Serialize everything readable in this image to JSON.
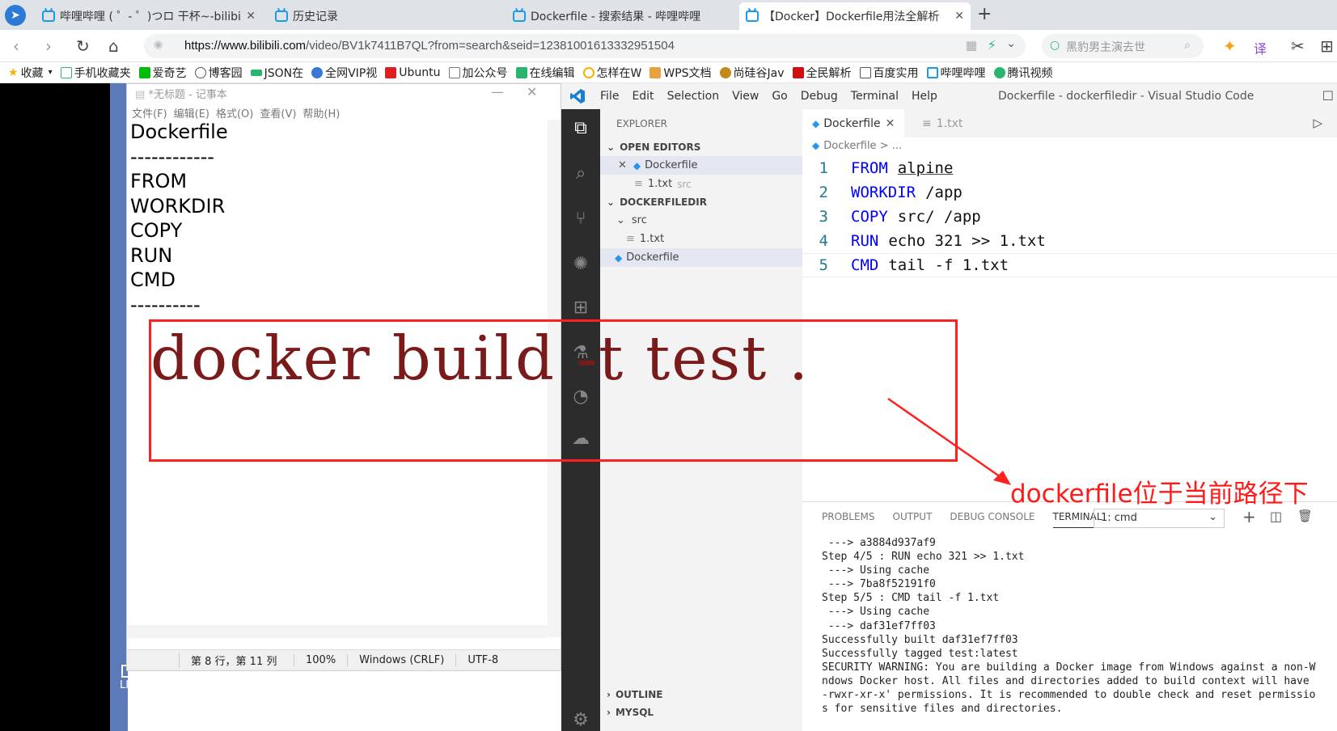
{
  "browser": {
    "tabs": [
      {
        "title": "哔哩哔哩 ( ゜- ゜)つロ 干杯~-bilibi",
        "active": false
      },
      {
        "title": "历史记录",
        "active": false
      },
      {
        "title": "Dockerfile - 搜索结果 - 哔哩哔哩",
        "active": false
      },
      {
        "title": "【Docker】Dockerfile用法全解析",
        "active": true
      }
    ],
    "url_host": "https://www.bilibili.com",
    "url_path": "/video/BV1k7411B7QL?from=search&seid=12381001613332951504",
    "search_placeholder": "黑豹男主演去世",
    "bookmarks": [
      "收藏",
      "手机收藏夹",
      "爱奇艺",
      "博客园",
      "JSON在",
      "全网VIP视",
      "Ubuntu",
      "加公众号",
      "在线编辑",
      "怎样在W",
      "WPS文档",
      "尚硅谷Jav",
      "全民解析",
      "百度实用",
      "哔哩哔哩",
      "腾讯视频"
    ]
  },
  "desktop": {
    "licecap_label": "LICEcap"
  },
  "notepad": {
    "title": "*无标题 - 记事本",
    "menu": [
      "文件(F)",
      "编辑(E)",
      "格式(O)",
      "查看(V)",
      "帮助(H)"
    ],
    "text": "Dockerfile\n------------\nFROM\nWORKDIR\nCOPY\nRUN\nCMD\n----------",
    "status": {
      "position": "第 8 行，第 11 列",
      "zoom": "100%",
      "line_ending": "Windows (CRLF)",
      "encoding": "UTF-8"
    }
  },
  "vscode": {
    "menu": [
      "File",
      "Edit",
      "Selection",
      "View",
      "Go",
      "Debug",
      "Terminal",
      "Help"
    ],
    "window_title": "Dockerfile - dockerfiledir - Visual Studio Code",
    "explorer_title": "EXPLORER",
    "open_editors_title": "OPEN EDITORS",
    "open_editors": [
      {
        "name": "Dockerfile",
        "extra": ""
      },
      {
        "name": "1.txt",
        "extra": "src"
      }
    ],
    "folder_title": "DOCKERFILEDIR",
    "tree": {
      "src": "src",
      "file1": "1.txt",
      "dockerfile": "Dockerfile"
    },
    "outline_title": "OUTLINE",
    "mysql_title": "MYSQL",
    "editor_tabs": [
      {
        "name": "Dockerfile",
        "active": true
      },
      {
        "name": "1.txt",
        "active": false
      }
    ],
    "breadcrumb": "Dockerfile > ...",
    "code_lines": [
      {
        "n": "1",
        "kw": "FROM",
        "arg": "alpine"
      },
      {
        "n": "2",
        "kw": "WORKDIR",
        "arg": "/app"
      },
      {
        "n": "3",
        "kw": "COPY",
        "arg": "src/ /app"
      },
      {
        "n": "4",
        "kw": "RUN",
        "arg": "echo 321 >> 1.txt"
      },
      {
        "n": "5",
        "kw": "CMD",
        "arg": "tail -f 1.txt"
      }
    ],
    "panel_tabs": [
      "PROBLEMS",
      "OUTPUT",
      "DEBUG CONSOLE",
      "TERMINAL"
    ],
    "terminal_select": "1: cmd",
    "terminal_output": " ---> a3884d937af9\nStep 4/5 : RUN echo 321 >> 1.txt\n ---> Using cache\n ---> 7ba8f52191f0\nStep 5/5 : CMD tail -f 1.txt\n ---> Using cache\n ---> daf31ef7ff03\nSuccessfully built daf31ef7ff03\nSuccessfully tagged test:latest\nSECURITY WARNING: You are building a Docker image from Windows against a non-W\nndows Docker host. All files and directories added to build context will have\n-rwxr-xr-x' permissions. It is recommended to double check and reset permissio\ns for sensitive files and directories."
  },
  "annotation": {
    "command": "docker build -t test .",
    "note": "dockerfile位于当前路径下",
    "color": "#ff2020"
  }
}
